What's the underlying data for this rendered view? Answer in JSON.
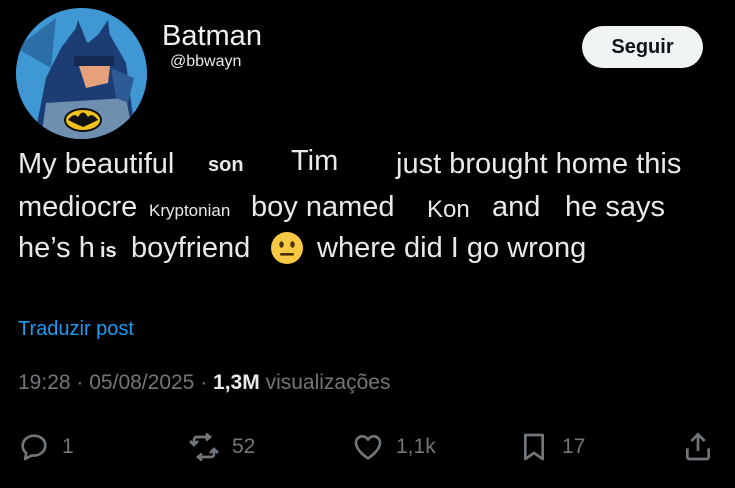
{
  "author": {
    "name": "Batman",
    "handle": "@bbwayn"
  },
  "follow_label": "Seguir",
  "tweet": {
    "line1": {
      "a": "My beautiful",
      "b": "son",
      "c": "Tim",
      "d": "just brought home this"
    },
    "line2": {
      "a": "mediocre",
      "b": "Kryptonian",
      "c": "boy named",
      "d": "Kon",
      "e": "and",
      "f": "he says"
    },
    "line3": {
      "a": "he’s h",
      "b": "is",
      "c": "boyfriend",
      "d": "where did I go wrong"
    }
  },
  "translate_label": "Traduzir post",
  "meta": {
    "time": "19:28",
    "sep1": "·",
    "date": "05/08/2025",
    "sep2": "·",
    "views": "1,3M",
    "views_label": "visualizações"
  },
  "actions": {
    "replies": "1",
    "reposts": "52",
    "likes": "1,1k",
    "bookmarks": "17"
  },
  "icons": [
    "reply-icon",
    "repost-icon",
    "like-icon",
    "bookmark-icon",
    "share-icon",
    "neutral-face-emoji"
  ]
}
